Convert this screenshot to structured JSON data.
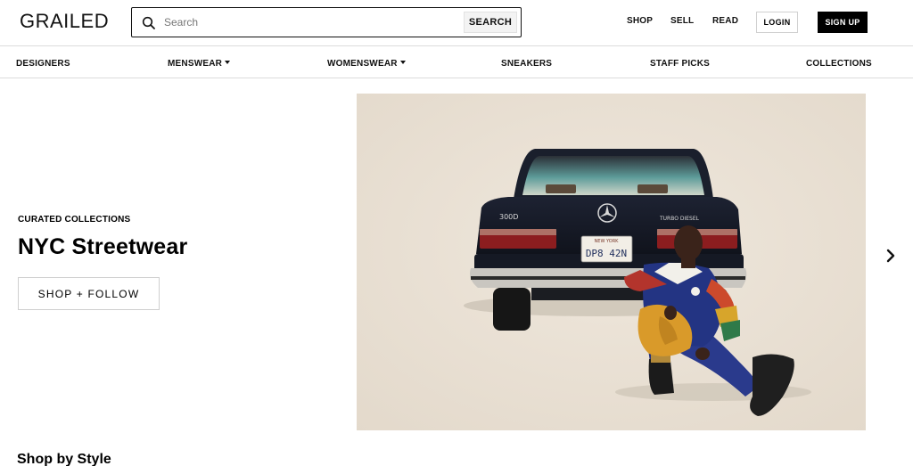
{
  "header": {
    "logo": "GRAILED",
    "search_placeholder": "Search",
    "search_button": "SEARCH",
    "nav": [
      "SHOP",
      "SELL",
      "READ"
    ],
    "login": "LOGIN",
    "signup": "SIGN UP"
  },
  "categories": [
    {
      "label": "DESIGNERS",
      "dropdown": false
    },
    {
      "label": "MENSWEAR",
      "dropdown": true
    },
    {
      "label": "WOMENSWEAR",
      "dropdown": true
    },
    {
      "label": "SNEAKERS",
      "dropdown": false
    },
    {
      "label": "STAFF PICKS",
      "dropdown": false
    },
    {
      "label": "COLLECTIONS",
      "dropdown": false
    }
  ],
  "hero": {
    "eyebrow": "CURATED COLLECTIONS",
    "title": "NYC Streetwear",
    "cta": "SHOP + FOLLOW",
    "image": {
      "car_badge": "300D",
      "car_trim": "TURBO DIESEL",
      "plate_state": "NEW YORK",
      "plate_text": "DP8 42N"
    }
  },
  "shop_by_style": {
    "title": "Shop by Style"
  },
  "icons": {
    "search": "search-icon",
    "next": "chevron-right-icon"
  },
  "colors": {
    "primary": "#000000",
    "background": "#ffffff",
    "border": "#dcdcdc"
  }
}
